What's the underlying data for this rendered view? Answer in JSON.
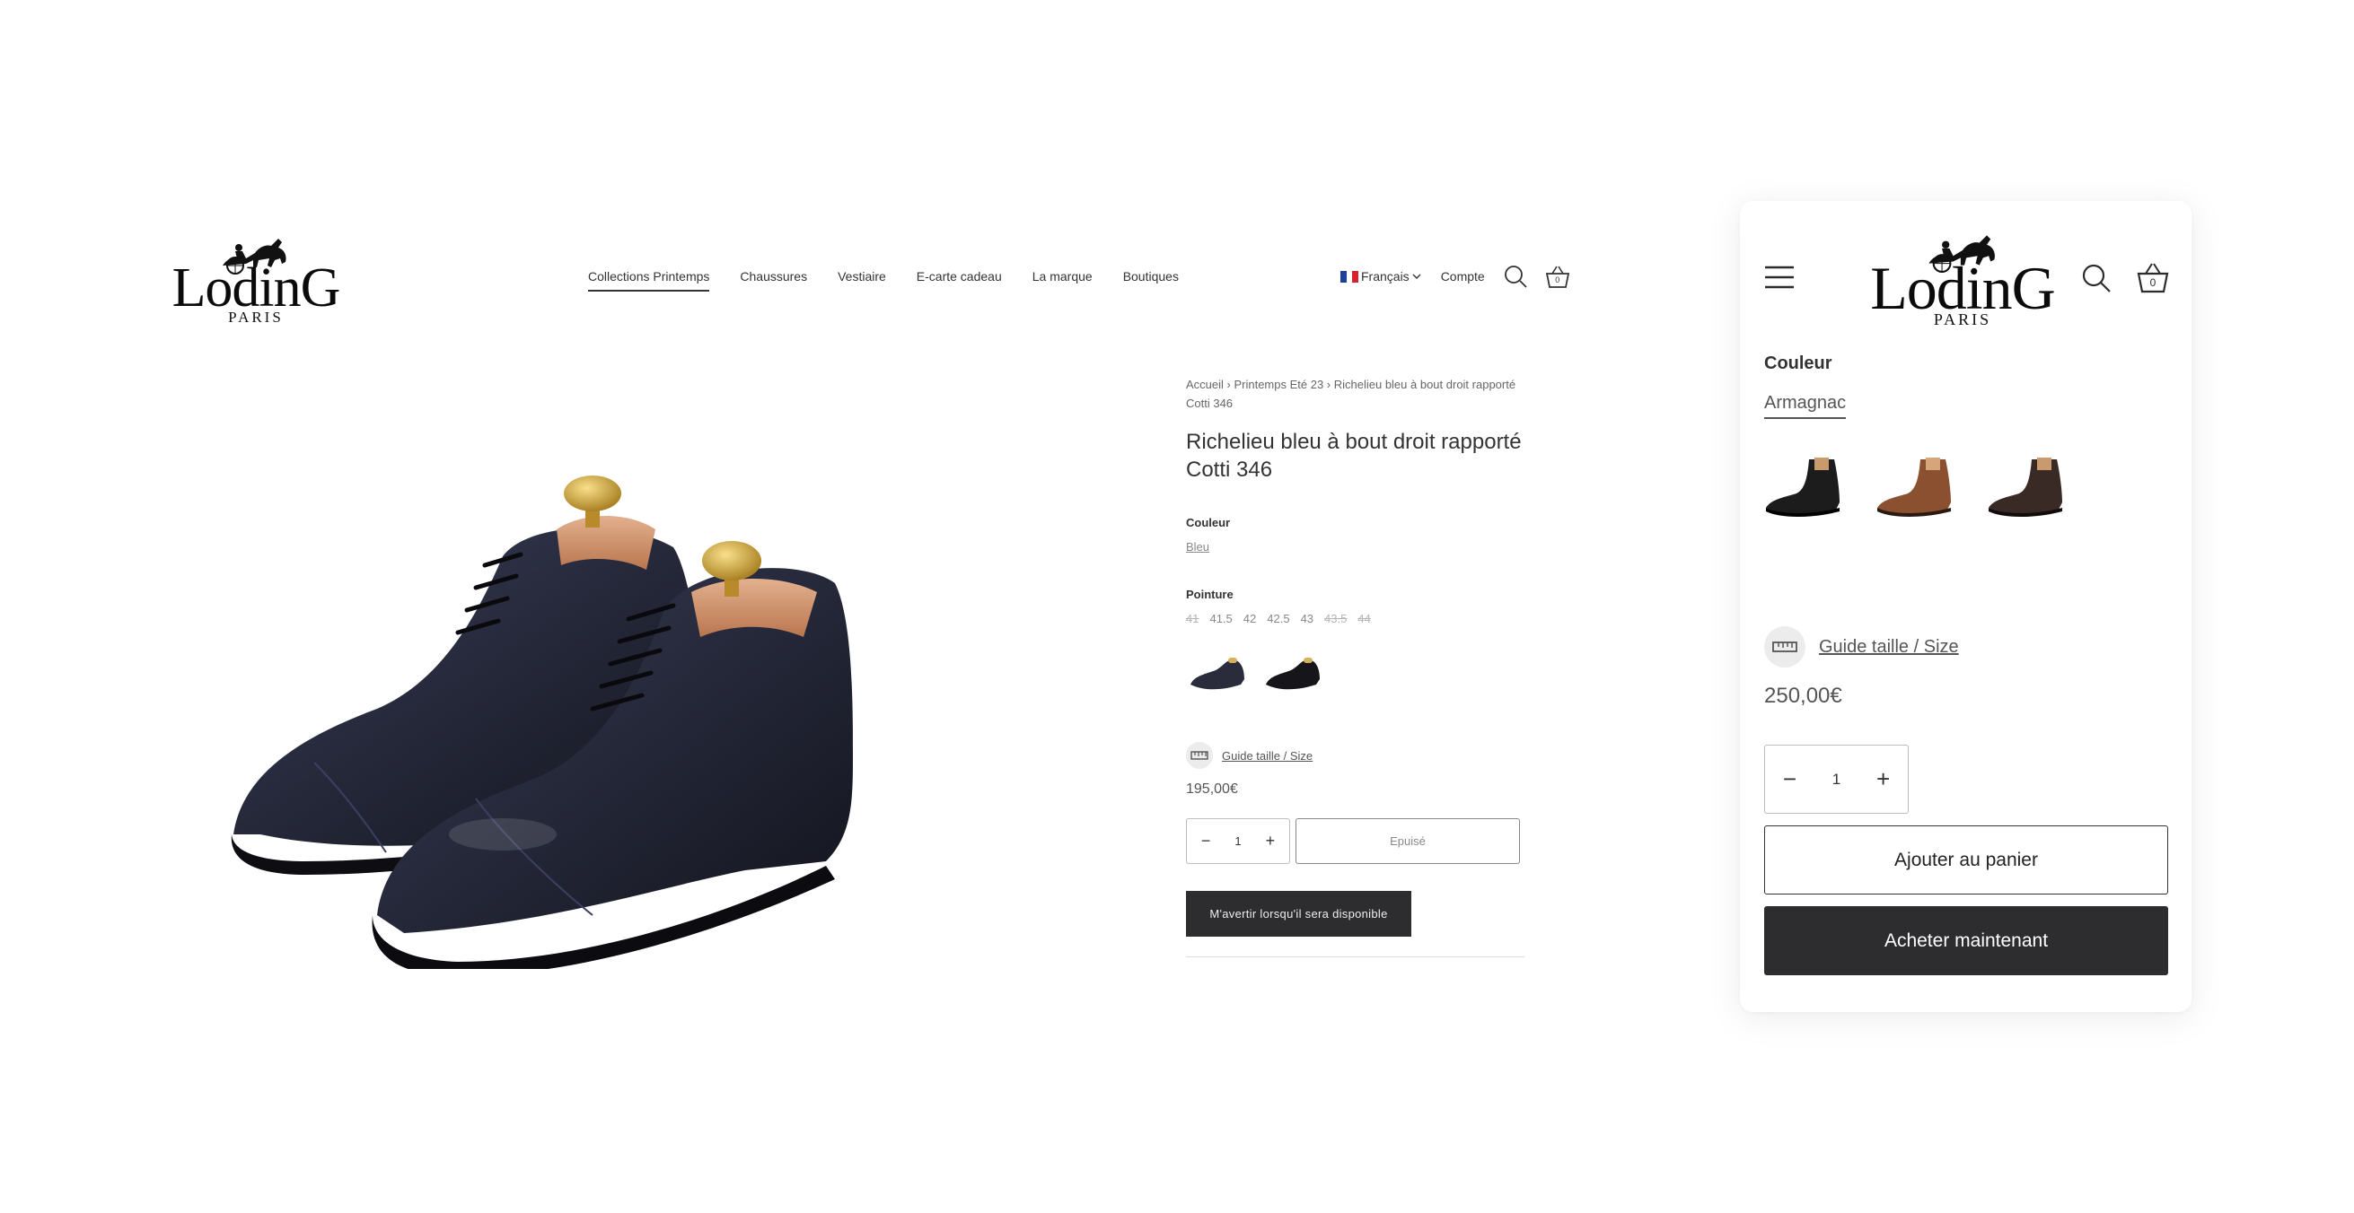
{
  "brand": {
    "name": "LodinG",
    "sub": "PARIS"
  },
  "nav": {
    "items": [
      "Collections Printemps",
      "Chaussures",
      "Vestiaire",
      "E-carte cadeau",
      "La marque",
      "Boutiques"
    ],
    "language": "Français",
    "account": "Compte",
    "cart_count": "0"
  },
  "product": {
    "breadcrumb": "Accueil › Printemps Eté 23 › Richelieu bleu à bout droit rapporté Cotti 346",
    "title": "Richelieu bleu à bout droit rapporté Cotti 346",
    "color_label": "Couleur",
    "color_value": "Bleu",
    "size_label": "Pointure",
    "sizes": [
      {
        "label": "41",
        "available": false
      },
      {
        "label": "41.5",
        "available": true
      },
      {
        "label": "42",
        "available": true
      },
      {
        "label": "42.5",
        "available": true
      },
      {
        "label": "43",
        "available": true
      },
      {
        "label": "43.5",
        "available": false
      },
      {
        "label": "44",
        "available": false
      }
    ],
    "guide": "Guide taille / Size",
    "price": "195,00€",
    "qty": "1",
    "soldout": "Epuisé",
    "notify": "M'avertir lorsqu'il sera disponible"
  },
  "mobile": {
    "color_label": "Couleur",
    "color_value": "Armagnac",
    "guide": "Guide taille / Size",
    "price": "250,00€",
    "qty": "1",
    "add_to_cart": "Ajouter au panier",
    "buy_now": "Acheter maintenant",
    "cart_count": "0"
  },
  "colors": {
    "shoe_navy": "#26283a",
    "dark_button": "#2d2d2f",
    "armagnac": "#8a5030",
    "black_shoe": "#1c1c1c",
    "dark_brown_shoe": "#3a2a26"
  },
  "icons": [
    "search-icon",
    "basket-icon",
    "chevron-down-icon",
    "hamburger-icon",
    "ruler-icon",
    "minus-icon",
    "plus-icon"
  ]
}
